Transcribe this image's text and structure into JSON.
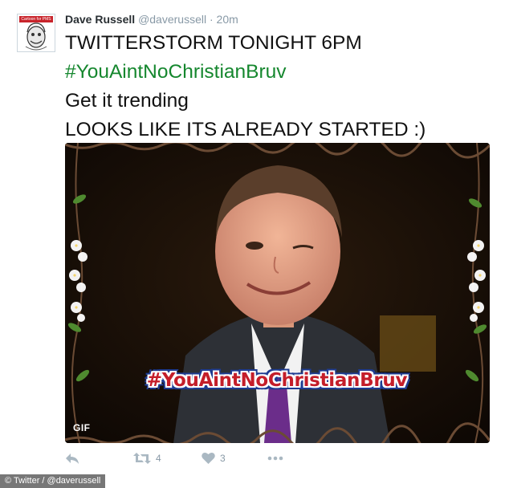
{
  "tweet": {
    "name": "Dave Russell",
    "handle": "@daverussell",
    "separator": "·",
    "time": "20m",
    "avatar_banner": "Cartoon for PMS",
    "lines": [
      {
        "text": "TWITTERSTORM TONIGHT 6PM",
        "type": "text"
      },
      {
        "text": "#YouAintNoChristianBruv",
        "type": "hashtag"
      },
      {
        "text": "Get it trending",
        "type": "text"
      },
      {
        "text": "LOOKS LIKE ITS ALREADY STARTED :)",
        "type": "text"
      }
    ],
    "media": {
      "hashtag_overlay": "#YouAintNoChristianBruv",
      "badge": "GIF"
    },
    "actions": {
      "reply_icon": "reply-icon",
      "retweet_icon": "retweet-icon",
      "retweet_count": "4",
      "like_icon": "heart-icon",
      "like_count": "3",
      "more_icon": "more-icon"
    }
  },
  "credit": "© Twitter / @daverussell",
  "colors": {
    "hashtag": "#15872e",
    "name": "#292f33",
    "meta": "#8899a6",
    "action_icon": "#aab8c2",
    "overlay_red": "#c41e2a",
    "overlay_blue": "#1e3c92"
  }
}
